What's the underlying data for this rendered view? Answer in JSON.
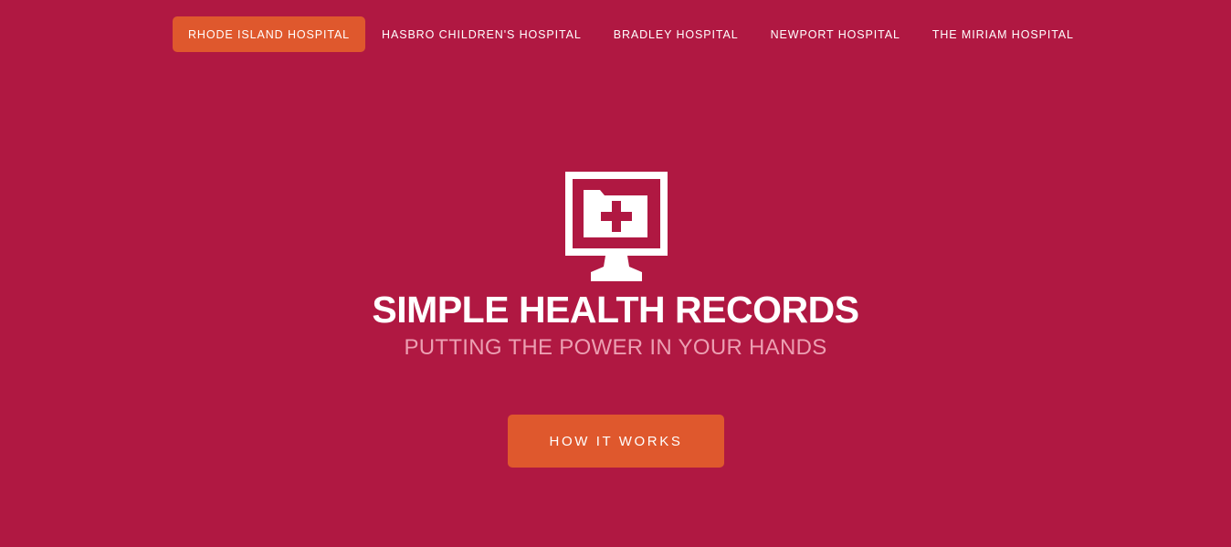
{
  "nav": {
    "items": [
      {
        "label": "RHODE ISLAND HOSPITAL",
        "active": true
      },
      {
        "label": "HASBRO CHILDREN'S HOSPITAL",
        "active": false
      },
      {
        "label": "BRADLEY HOSPITAL",
        "active": false
      },
      {
        "label": "NEWPORT HOSPITAL",
        "active": false
      },
      {
        "label": "THE MIRIAM HOSPITAL",
        "active": false
      }
    ]
  },
  "hero": {
    "icon": "health-records-monitor-icon",
    "title": "SIMPLE HEALTH RECORDS",
    "subtitle": "PUTTING THE POWER IN YOUR HANDS",
    "cta_label": "HOW IT WORKS"
  },
  "colors": {
    "background": "#b01842",
    "accent": "#df582d",
    "subtitle": "#ec9fb2",
    "text": "#ffffff"
  }
}
